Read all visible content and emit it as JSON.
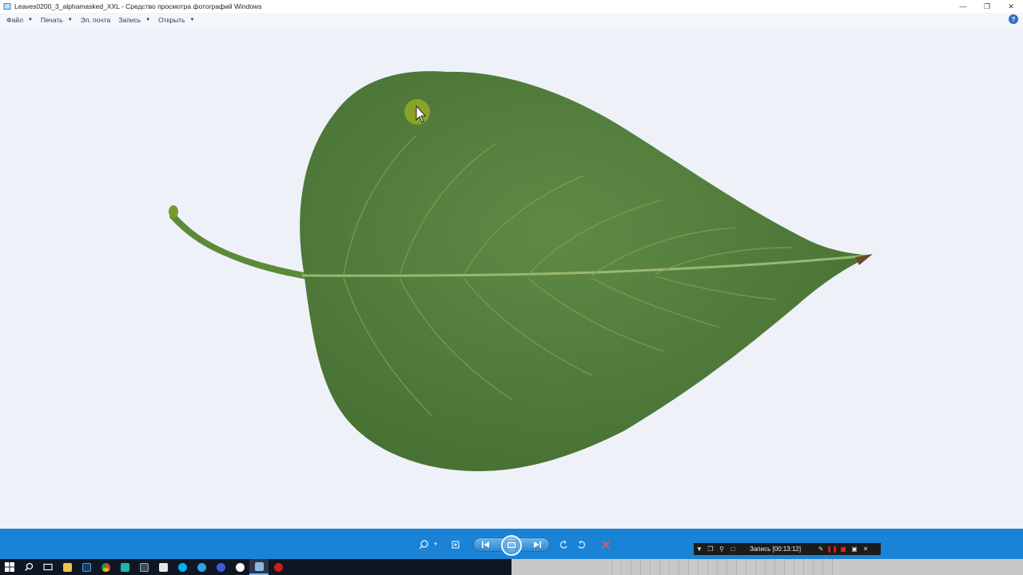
{
  "window": {
    "title": "Leaves0200_3_alphamasked_XXL - Средство просмотра фотографий Windows",
    "controls": [
      "minimize",
      "restore",
      "close"
    ]
  },
  "menu": [
    {
      "label": "Файл",
      "has_dropdown": true
    },
    {
      "label": "Печать",
      "has_dropdown": true
    },
    {
      "label": "Эл. почта",
      "has_dropdown": false
    },
    {
      "label": "Запись",
      "has_dropdown": true
    },
    {
      "label": "Открыть",
      "has_dropdown": true
    }
  ],
  "image": {
    "subject": "green leaf",
    "colors": {
      "leaf": "#4f7a3a",
      "leaf_light": "#6b9450",
      "vein": "#9ab86e",
      "background": "#eef2f8"
    }
  },
  "toolbar": {
    "buttons": [
      "zoom-icon",
      "fit-window-icon",
      "previous-icon",
      "slideshow-icon",
      "next-icon",
      "rotate-left-icon",
      "rotate-right-icon",
      "delete-icon"
    ],
    "color": "#1a83d6"
  },
  "recorder": {
    "status_text": "Запись [00:13:12]",
    "icons": [
      "dropdown-icon",
      "window-icon",
      "zoom-icon",
      "region-icon",
      "pen-icon",
      "pause-icon",
      "stop-icon",
      "camera-icon",
      "close-icon"
    ]
  },
  "taskbar": {
    "icons": [
      "start-icon",
      "search-icon",
      "task-view-icon",
      "explorer-icon",
      "photoshop-icon",
      "chrome-icon",
      "app-icon",
      "app2-icon",
      "notes-icon",
      "skype-icon",
      "telegram-icon",
      "vpn-icon",
      "yandex-icon",
      "photo-viewer-icon",
      "recorder-icon"
    ]
  }
}
